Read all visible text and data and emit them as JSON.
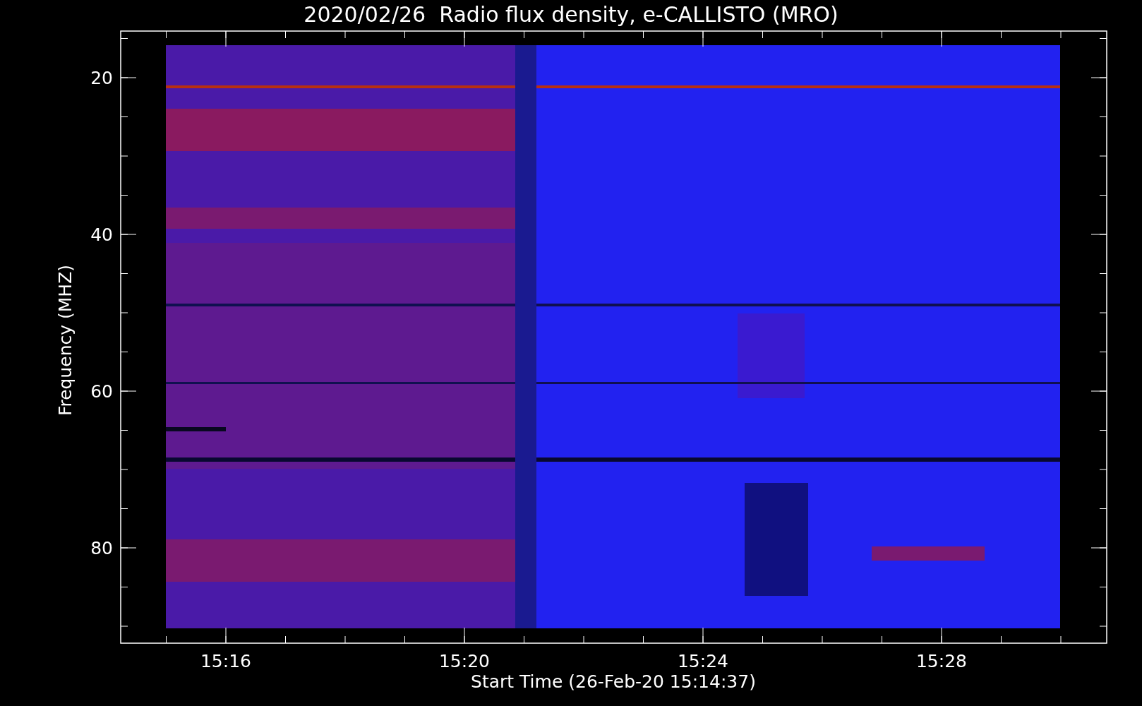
{
  "title": "2020/02/26  Radio flux density, e-CALLISTO (MRO)",
  "x_axis": {
    "label": "Start Time (26-Feb-20 15:14:37)",
    "ticks": [
      "15:16",
      "15:20",
      "15:24",
      "15:28"
    ]
  },
  "y_axis": {
    "label": "Frequency (MHZ)",
    "ticks": [
      "20",
      "40",
      "60",
      "80"
    ]
  }
}
